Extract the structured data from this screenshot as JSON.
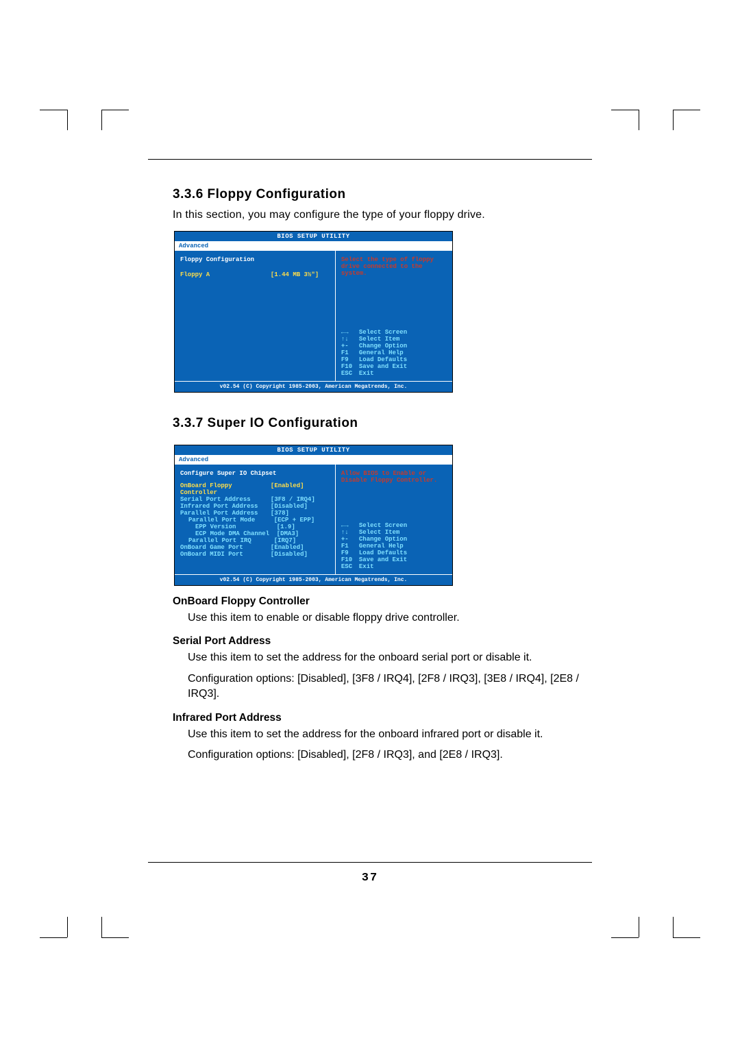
{
  "page_number": "37",
  "section1": {
    "heading": "3.3.6 Floppy Configuration",
    "intro": "In this section, you may configure the type of your floppy drive."
  },
  "section2": {
    "heading": "3.3.7 Super IO Configuration"
  },
  "bios_common": {
    "title": "BIOS SETUP UTILITY",
    "tab": "Advanced",
    "copyright": "v02.54 (C) Copyright 1985-2003, American Megatrends, Inc."
  },
  "bios1": {
    "panel_title": "Floppy Configuration",
    "row_label": "Floppy A",
    "row_value": "[1.44 MB  3½\"]",
    "help": "Select the type of floppy drive connected to the system."
  },
  "bios2": {
    "panel_title": "Configure Super IO Chipset",
    "rows": [
      {
        "lbl": "OnBoard Floppy Controller",
        "val": "[Enabled]"
      },
      {
        "lbl": "Serial Port Address",
        "val": "[3F8 / IRQ4]"
      },
      {
        "lbl": "Infrared Port Address",
        "val": "[Disabled]"
      },
      {
        "lbl": "Parallel Port Address",
        "val": "[378]"
      },
      {
        "lbl": "Parallel Port Mode",
        "val": "[ECP + EPP]"
      },
      {
        "lbl": "EPP Version",
        "val": "[1.9]"
      },
      {
        "lbl": "ECP Mode DMA Channel",
        "val": "[DMA3]"
      },
      {
        "lbl": "Parallel Port IRQ",
        "val": "[IRQ7]"
      },
      {
        "lbl": "OnBoard Game Port",
        "val": "[Enabled]"
      },
      {
        "lbl": "OnBoard MIDI Port",
        "val": "[Disabled]"
      }
    ],
    "help": "Allow BIOS to Enable or Disable Floppy Controller."
  },
  "nav": [
    {
      "key": "←→",
      "label": "Select Screen"
    },
    {
      "key": "↑↓",
      "label": "Select Item"
    },
    {
      "key": "+-",
      "label": "Change Option"
    },
    {
      "key": "F1",
      "label": "General Help"
    },
    {
      "key": "F9",
      "label": "Load Defaults"
    },
    {
      "key": "F10",
      "label": "Save and Exit"
    },
    {
      "key": "ESC",
      "label": "Exit"
    }
  ],
  "desc": {
    "floppy_ctrl_head": "OnBoard Floppy Controller",
    "floppy_ctrl_body": "Use this item to enable or disable floppy drive controller.",
    "serial_head": "Serial Port Address",
    "serial_body1": "Use this item to set the address for the onboard serial port or disable it.",
    "serial_body2": "Configuration options: [Disabled], [3F8 / IRQ4], [2F8 / IRQ3], [3E8 / IRQ4], [2E8 / IRQ3].",
    "infrared_head": "Infrared Port Address",
    "infrared_body1": "Use this item to set the address for the onboard infrared port or disable it.",
    "infrared_body2": "Configuration options: [Disabled], [2F8 / IRQ3], and [2E8 / IRQ3]."
  }
}
